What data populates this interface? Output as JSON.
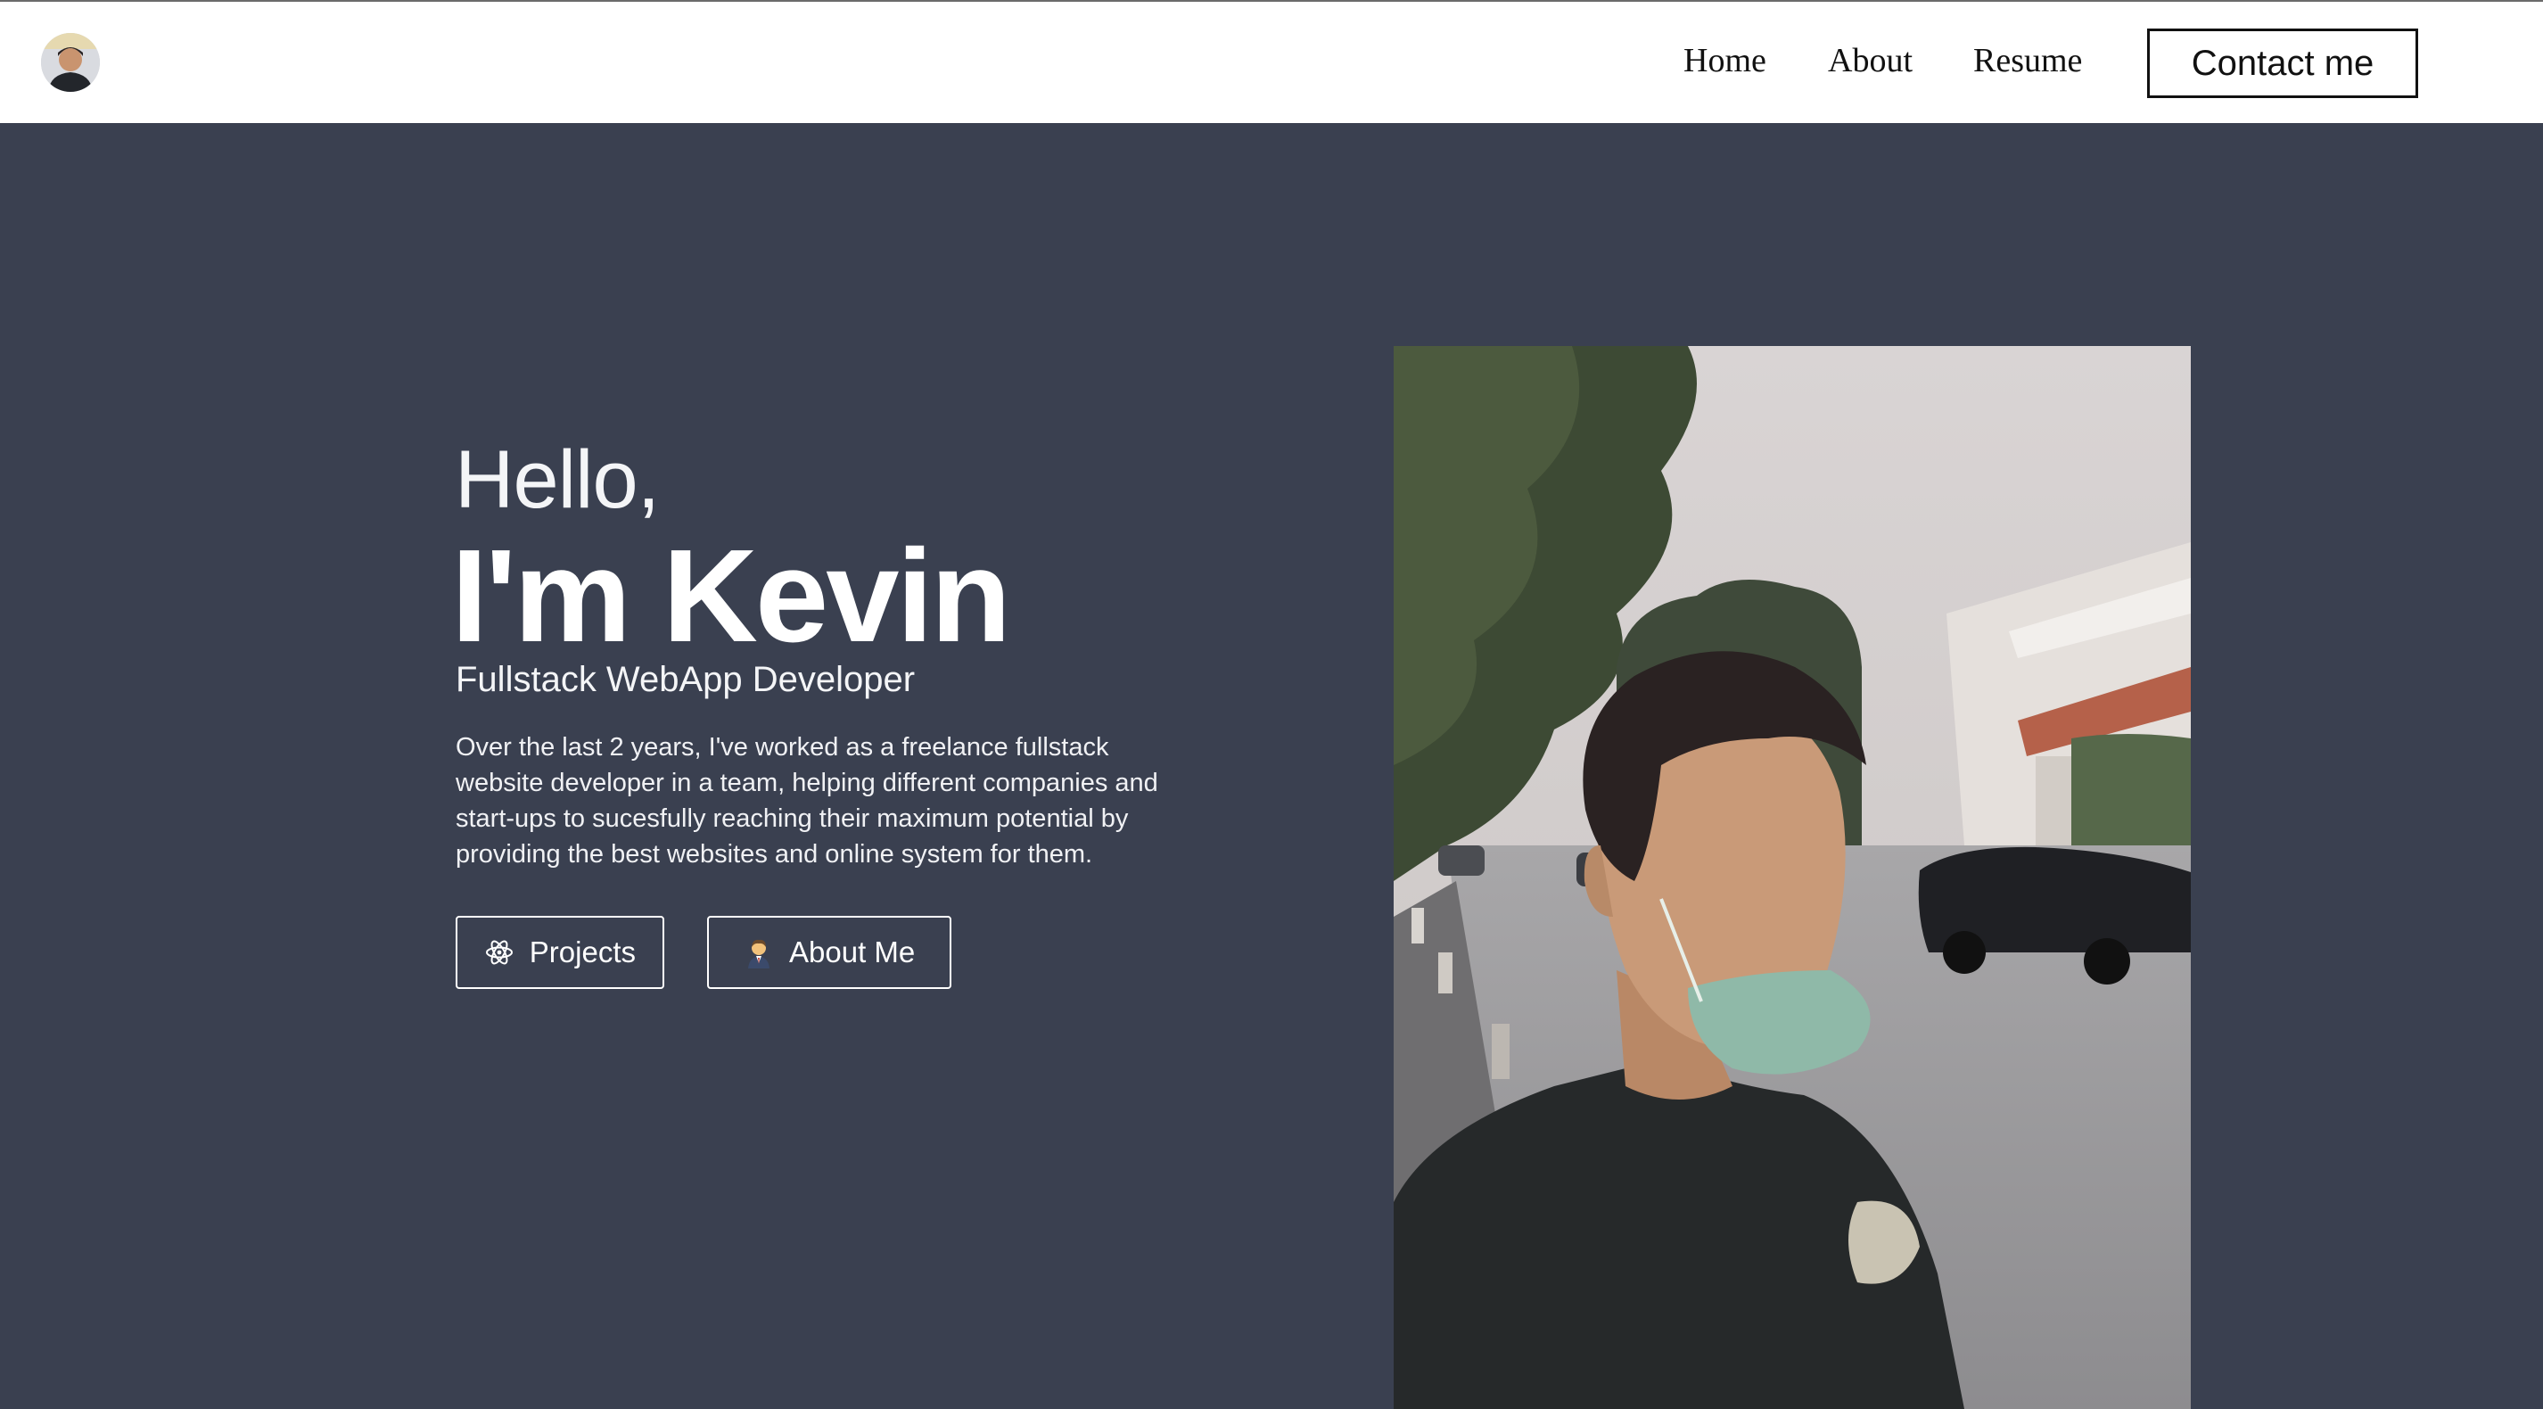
{
  "header": {
    "logo_alt": "Kevin avatar",
    "nav": {
      "home": "Home",
      "about": "About",
      "resume": "Resume",
      "contact": "Contact me"
    }
  },
  "hero": {
    "greeting": "Hello,",
    "name": "I'm Kevin",
    "role": "Fullstack WebApp Developer",
    "bio": "Over the last 2 years, I've worked as a freelance fullstack website developer in a team, helping different companies and start-ups to sucesfully reaching their maximum potential by providing the best websites and online system for them.",
    "buttons": {
      "projects": {
        "label": "Projects",
        "icon": "react-atom-icon"
      },
      "about": {
        "label": "About Me",
        "icon": "person-emoji-icon"
      }
    }
  },
  "portrait": {
    "alt": "Photo of Kevin on a street"
  },
  "colors": {
    "header_bg": "#ffffff",
    "hero_bg": "#3a4050",
    "text_light": "#ffffff",
    "nav_text": "#111111"
  }
}
